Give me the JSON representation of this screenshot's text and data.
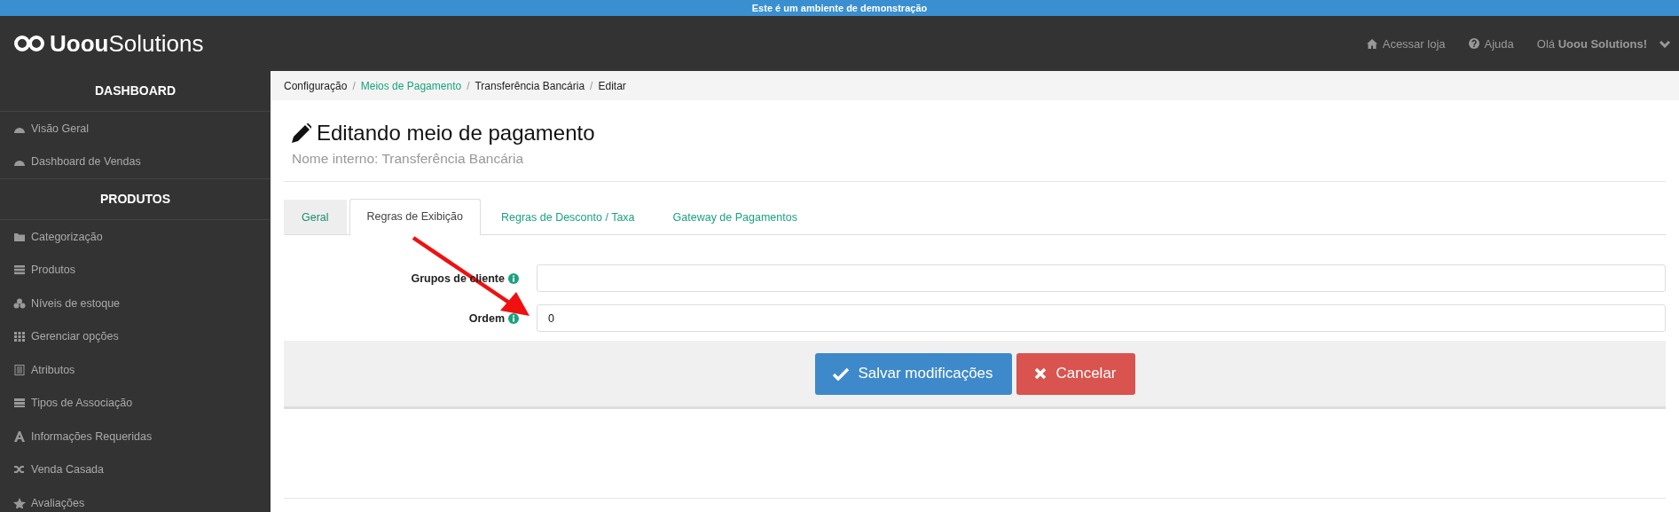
{
  "banner": "Este é um ambiente de demonstração",
  "logo": {
    "bold": "Uoou",
    "light": "Solutions"
  },
  "header_links": [
    {
      "kind": "home",
      "label": "Acessar loja"
    },
    {
      "kind": "help",
      "label": "Ajuda"
    },
    {
      "kind": "user",
      "label": "Olá **Uoou Solutions!**"
    }
  ],
  "sidebar": [
    {
      "title": "DASHBOARD",
      "items": [
        "Visão Geral",
        "Dashboard de Vendas"
      ]
    },
    {
      "title": "PRODUTOS",
      "items": [
        "Categorização",
        "Produtos",
        "Níveis de estoque",
        "Gerenciar opções",
        "Atributos",
        "Tipos de Associação",
        "Informações Requeridas",
        "Venda Casada",
        "Avaliações"
      ]
    }
  ],
  "breadcrumb": [
    {
      "label": "Configuração",
      "kind": "text"
    },
    {
      "separator": "/",
      "label": "Meios de Pagamento",
      "kind": "link"
    },
    {
      "separator": "/",
      "label": "Transferência Bancária",
      "kind": "text"
    },
    {
      "separator": "/",
      "label": "Editar",
      "kind": "text"
    }
  ],
  "title": "Editando meio de pagamento",
  "subtitle": "Nome interno: Transferência Bancária",
  "tabs": [
    {
      "label": "Geral",
      "selected": false
    },
    {
      "label": "Regras de Exibição",
      "selected": true
    },
    {
      "label": "Regras de Desconto / Taxa",
      "selected": false
    },
    {
      "label": "Gateway de Pagamentos",
      "selected": false
    }
  ],
  "fields": [
    {
      "label": "Grupos de cliente"
    },
    {
      "label": "Ordem",
      "value": "0"
    }
  ],
  "buttons": [
    {
      "kind": "primary",
      "label": "Salvar modificações"
    },
    {
      "kind": "danger",
      "label": "Cancelar"
    }
  ]
}
